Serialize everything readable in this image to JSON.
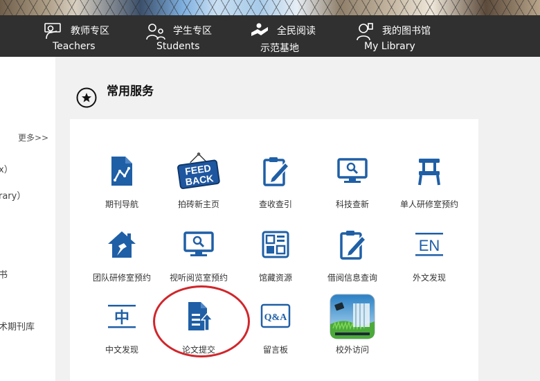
{
  "nav": {
    "items": [
      {
        "cn": "教师专区",
        "en": "Teachers",
        "icon": "teacher-icon"
      },
      {
        "cn": "学生专区",
        "en": "Students",
        "icon": "students-icon"
      },
      {
        "cn": "全民阅读",
        "en": "示范基地",
        "icon": "reading-icon"
      },
      {
        "cn": "我的图书馆",
        "en": "My Library",
        "icon": "my-library-icon"
      }
    ]
  },
  "left": {
    "more": "更多>>",
    "fragments": [
      "x）",
      "rary）",
      "书",
      "术期刊库"
    ]
  },
  "section": {
    "title": "常用服务",
    "icon": "star-circle-icon"
  },
  "services": [
    {
      "label": "期刊导航",
      "icon": "journal-nav-icon"
    },
    {
      "label": "拍砖新主页",
      "icon": "feedback-sign-icon",
      "sign_text": [
        "FEED",
        "BACK"
      ]
    },
    {
      "label": "查收查引",
      "icon": "edit-doc-icon"
    },
    {
      "label": "科技查新",
      "icon": "monitor-search-icon"
    },
    {
      "label": "单人研修室预约",
      "icon": "chair-icon"
    },
    {
      "label": "团队研修室预约",
      "icon": "house-pin-icon"
    },
    {
      "label": "视听阅览室预约",
      "icon": "monitor-search-icon"
    },
    {
      "label": "馆藏资源",
      "icon": "grid-resources-icon"
    },
    {
      "label": "借阅信息查询",
      "icon": "edit-doc-icon"
    },
    {
      "label": "外文发现",
      "icon": "en-discovery-icon",
      "glyph": "EN"
    },
    {
      "label": "中文发现",
      "icon": "zh-discovery-icon",
      "glyph": "中"
    },
    {
      "label": "论文提交",
      "icon": "upload-doc-icon"
    },
    {
      "label": "留言板",
      "icon": "qa-board-icon",
      "glyph": "Q&A"
    },
    {
      "label": "校外访问",
      "icon": "offcampus-app-icon"
    }
  ],
  "colors": {
    "accent": "#1f5fa6",
    "nav_bg": "#303030",
    "highlight": "#d0262b"
  }
}
